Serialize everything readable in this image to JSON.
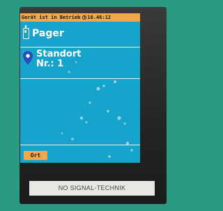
{
  "status_bar": {
    "message": "Gerät ist in Betrieb",
    "time": "10.46:12"
  },
  "menu": {
    "pager_label": "Pager",
    "location_line1": "Standort",
    "location_line2": "Nr.: 1"
  },
  "softkey": {
    "left_label": "Ort"
  },
  "device_label": "NO SIGNAL-TECHNIK",
  "icons": {
    "pager": "pager-icon",
    "location": "location-pin-icon",
    "clock": "clock-icon"
  },
  "colors": {
    "background": "#2a9a82",
    "screen": "#16a3cc",
    "status_bar": "#f3a64a",
    "pin": "#2b4fb8"
  }
}
